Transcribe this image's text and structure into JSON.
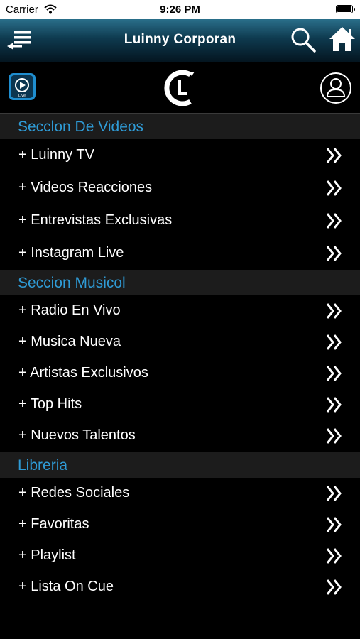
{
  "status_bar": {
    "carrier": "Carrier",
    "time": "9:26 PM",
    "battery_level": 1.0
  },
  "nav": {
    "title": "Luinny Corporan",
    "icons": [
      "menu-back-icon",
      "search-icon",
      "home-icon"
    ]
  },
  "logo_row": {
    "live_badge_text": "Live",
    "icons": [
      "live-video-icon",
      "brand-logo",
      "user-profile-icon"
    ]
  },
  "sections": [
    {
      "title": "Secclon De Videos",
      "items": [
        "+ Luinny TV",
        "+ Videos Reacciones",
        "+ Entrevistas Exclusivas",
        "+ Instagram Live"
      ]
    },
    {
      "title": "Seccion Musicol",
      "items": [
        "+ Radio En Vivo",
        "+ Musica Nueva",
        "+ Artistas Exclusivos",
        "+ Top Hits",
        "+ Nuevos Talentos"
      ]
    },
    {
      "title": "Libreria",
      "items": [
        "+ Redes Sociales",
        "+ Favoritas",
        "+ Playlist",
        "+ Lista On Cue"
      ]
    }
  ],
  "colors": {
    "section_title": "#2f9bd6",
    "section_bg": "#1c1c1c",
    "nav_gradient_top": "#2a6f8a",
    "nav_gradient_bottom": "#041520"
  }
}
